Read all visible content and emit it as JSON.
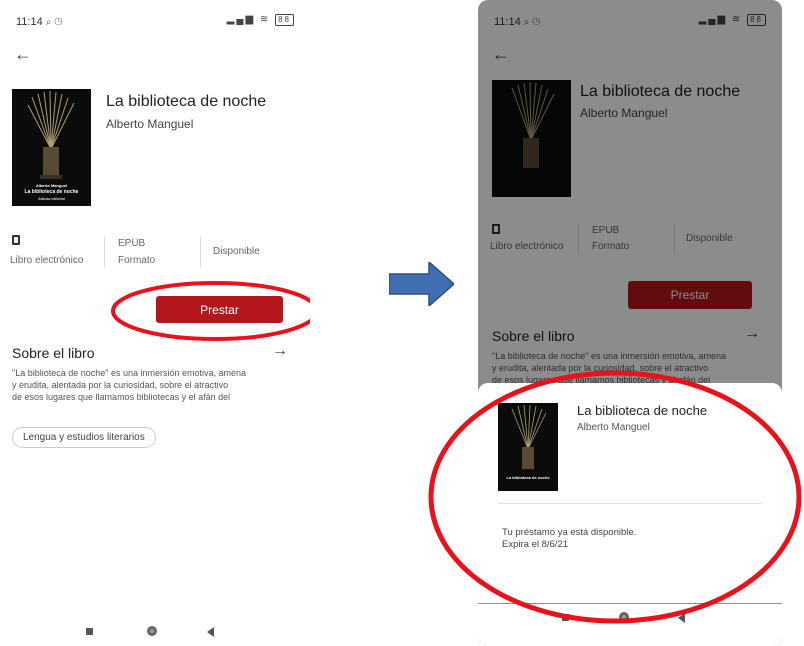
{
  "colors": {
    "accent": "#b3161b",
    "annotation": "#e8121b",
    "arrow": "#3f6fb0"
  },
  "status_bar": {
    "time": "11:14",
    "extra_icons": "⌕ ◷",
    "signal": "▂▄▆ ≋",
    "battery": "88"
  },
  "book": {
    "title": "La biblioteca de noche",
    "author": "Alberto Manguel",
    "cover_author": "Alberto Manguel",
    "cover_title": "La biblioteca de noche",
    "cover_publisher": "Alianza editorial"
  },
  "meta": {
    "type_label": "Libro electrónico",
    "format_value": "EPUB",
    "format_label": "Formato",
    "availability": "Disponible"
  },
  "borrow_button": "Prestar",
  "about": {
    "title": "Sobre el libro",
    "description_line1": "\"La biblioteca de noche\" es una inmersión emotiva, amena",
    "description_line2": "y erudita, alentada por la curiosidad, sobre el atractivo",
    "description_line3": "de esos lugares que llamamos bibliotecas y el afán del"
  },
  "genre_chip": "Lengua y estudios literarios",
  "loan_sheet": {
    "title": "La biblioteca de noche",
    "author": "Alberto Manguel",
    "message_line1": "Tu préstamo ya está disponible.",
    "message_line2": "Expira el 8/6/21"
  }
}
